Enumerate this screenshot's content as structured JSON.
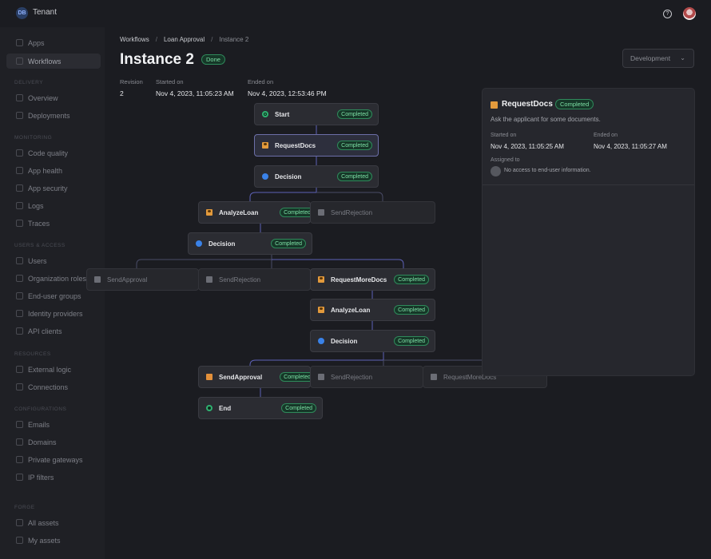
{
  "app": {
    "logo_text": "DB",
    "tenant": "Tenant"
  },
  "topbar": {
    "help_icon": "?"
  },
  "sidebar": {
    "items": [
      {
        "label": "Apps",
        "icon": "apps-icon"
      },
      {
        "label": "Workflows",
        "icon": "workflow-icon",
        "active": true
      },
      {
        "label": "Overview",
        "icon": "overview-icon"
      },
      {
        "label": "Deployments",
        "icon": "deploy-icon"
      },
      {
        "label": "Code quality",
        "icon": "code-icon"
      },
      {
        "label": "App health",
        "icon": "health-icon"
      },
      {
        "label": "App security",
        "icon": "shield-icon"
      },
      {
        "label": "Logs",
        "icon": "logs-icon"
      },
      {
        "label": "Traces",
        "icon": "traces-icon"
      },
      {
        "label": "Users",
        "icon": "users-icon"
      },
      {
        "label": "Organization roles",
        "icon": "roles-icon"
      },
      {
        "label": "End-user groups",
        "icon": "groups-icon"
      },
      {
        "label": "Identity providers",
        "icon": "idp-icon"
      },
      {
        "label": "API clients",
        "icon": "api-icon"
      },
      {
        "label": "External logic",
        "icon": "logic-icon"
      },
      {
        "label": "Connections",
        "icon": "connections-icon"
      },
      {
        "label": "Emails",
        "icon": "mail-icon"
      },
      {
        "label": "Domains",
        "icon": "globe-icon"
      },
      {
        "label": "Private gateways",
        "icon": "gateway-icon"
      },
      {
        "label": "IP filters",
        "icon": "filter-icon"
      },
      {
        "label": "All assets",
        "icon": "assets-icon"
      },
      {
        "label": "My assets",
        "icon": "my-assets-icon"
      }
    ],
    "sections": [
      "Delivery",
      "Monitoring",
      "Users & access",
      "Resources",
      "Configurations",
      "Forge"
    ]
  },
  "breadcrumb": {
    "items": [
      "Workflows",
      "Loan Approval",
      "Instance 2"
    ],
    "separator": "/"
  },
  "page": {
    "title": "Instance 2",
    "status": "Done"
  },
  "environment": {
    "selected": "Development",
    "chevron": "⌄"
  },
  "meta": {
    "revision_label": "Revision",
    "revision": "2",
    "started_label": "Started on",
    "started": "Nov 4, 2023, 11:05:23 AM",
    "ended_label": "Ended on",
    "ended": "Nov 4, 2023, 12:53:46 PM"
  },
  "graph": {
    "nodes": [
      {
        "label": "Start",
        "type": "start",
        "status": "Completed"
      },
      {
        "label": "RequestDocs",
        "type": "user",
        "status": "Completed",
        "selected": true
      },
      {
        "label": "Decision",
        "type": "decision",
        "status": "Completed"
      },
      {
        "label": "AnalyzeLoan",
        "type": "user",
        "status": "Completed"
      },
      {
        "label": "SendRejection",
        "type": "dim",
        "status": ""
      },
      {
        "label": "Decision",
        "type": "decision",
        "status": "Completed"
      },
      {
        "label": "SendApproval",
        "type": "dim",
        "status": ""
      },
      {
        "label": "SendRejection",
        "type": "dim",
        "status": ""
      },
      {
        "label": "RequestMoreDocs",
        "type": "user",
        "status": "Completed"
      },
      {
        "label": "AnalyzeLoan",
        "type": "user",
        "status": "Completed"
      },
      {
        "label": "Decision",
        "type": "decision",
        "status": "Completed"
      },
      {
        "label": "SendApproval",
        "type": "task",
        "status": "Completed"
      },
      {
        "label": "SendRejection",
        "type": "dim",
        "status": ""
      },
      {
        "label": "RequestMoreDocs",
        "type": "dim-user",
        "status": ""
      },
      {
        "label": "End",
        "type": "end",
        "status": "Completed"
      }
    ]
  },
  "detail": {
    "title": "RequestDocs",
    "status": "Completed",
    "description": "Ask the applicant for some documents.",
    "started_label": "Started on",
    "started": "Nov 4, 2023, 11:05:25 AM",
    "ended_label": "Ended on",
    "ended": "Nov 4, 2023, 11:05:27 AM",
    "assigned_label": "Assigned to",
    "assigned": "No access to end-user information."
  },
  "colors": {
    "accent": "#6c6fa8",
    "success": "#2fb070",
    "user_task": "#e39a3c",
    "decision": "#3a82e8",
    "edge": "#5e62b8"
  }
}
